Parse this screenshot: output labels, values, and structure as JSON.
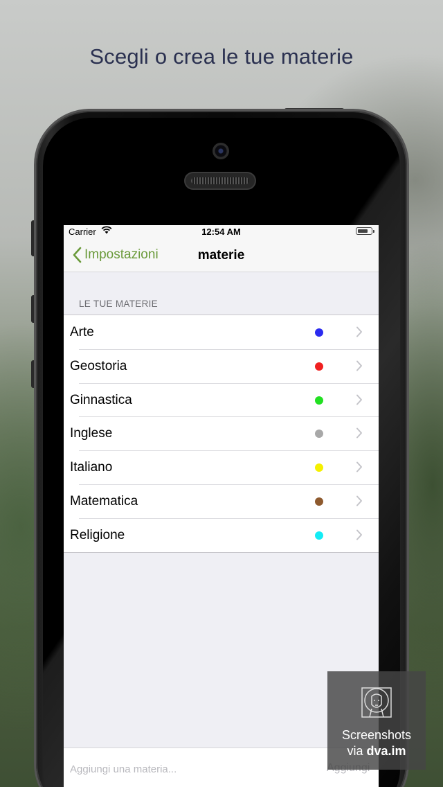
{
  "headline": "Scegli o crea le tue materie",
  "statusbar": {
    "carrier": "Carrier",
    "wifi_icon": "wifi-icon",
    "time": "12:54 AM",
    "battery_icon": "battery-icon"
  },
  "navbar": {
    "back_label": "Impostazioni",
    "back_icon": "chevron-left-icon",
    "title": "materie",
    "accent_color": "#6a9a3a"
  },
  "section_header": "LE TUE MATERIE",
  "subjects": [
    {
      "name": "Arte",
      "color": "#2b2bf0"
    },
    {
      "name": "Geostoria",
      "color": "#f02020"
    },
    {
      "name": "Ginnastica",
      "color": "#22e022"
    },
    {
      "name": "Inglese",
      "color": "#a8a8a8"
    },
    {
      "name": "Italiano",
      "color": "#f5f000"
    },
    {
      "name": "Matematica",
      "color": "#8e5a2e"
    },
    {
      "name": "Religione",
      "color": "#14ecf5"
    }
  ],
  "add_bar": {
    "placeholder": "Aggiungi una materia...",
    "button_label": "Aggiungi"
  },
  "watermark": {
    "line1": "Screenshots",
    "line2_prefix": "via ",
    "line2_brand": "dva.im"
  }
}
